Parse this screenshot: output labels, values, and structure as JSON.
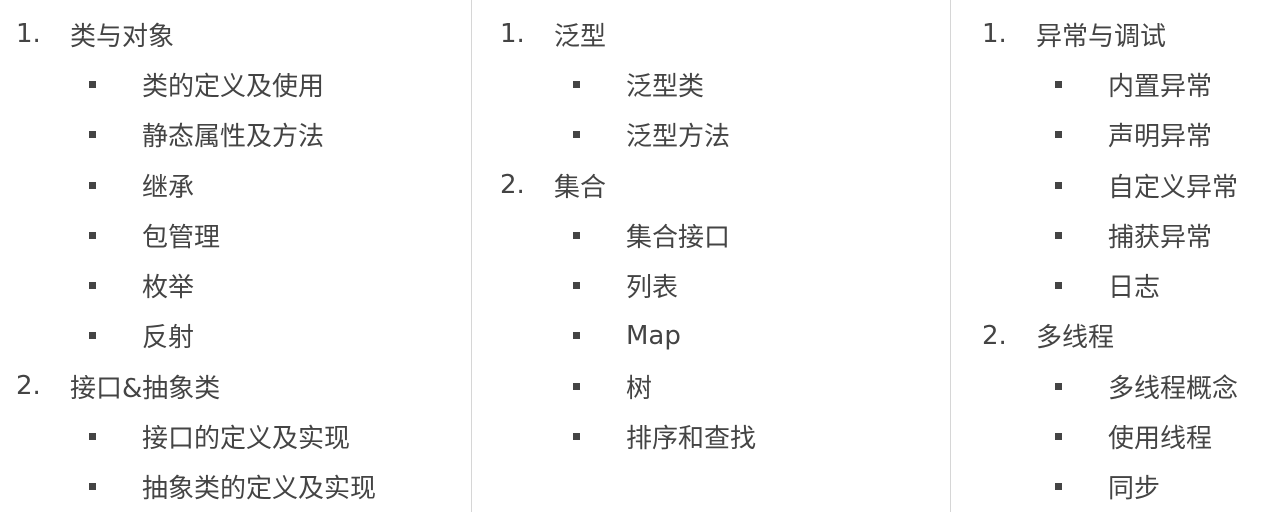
{
  "columns": [
    {
      "sections": [
        {
          "number": "1.",
          "title": "类与对象",
          "items": [
            "类的定义及使用",
            "静态属性及方法",
            "继承",
            "包管理",
            "枚举",
            "反射"
          ]
        },
        {
          "number": "2.",
          "title": "接口&抽象类",
          "items": [
            "接口的定义及实现",
            "抽象类的定义及实现"
          ]
        }
      ]
    },
    {
      "sections": [
        {
          "number": "1.",
          "title": "泛型",
          "items": [
            "泛型类",
            "泛型方法"
          ]
        },
        {
          "number": "2.",
          "title": "集合",
          "items": [
            "集合接口",
            "列表",
            "Map",
            "树",
            "排序和查找"
          ]
        }
      ]
    },
    {
      "sections": [
        {
          "number": "1.",
          "title": "异常与调试",
          "items": [
            "内置异常",
            "声明异常",
            "自定义异常",
            "捕获异常",
            "日志"
          ]
        },
        {
          "number": "2.",
          "title": "多线程",
          "items": [
            "多线程概念",
            "使用线程",
            "同步"
          ]
        }
      ]
    }
  ],
  "colors": {
    "text": "#444444",
    "divider": "#d6d6d6",
    "background": "#ffffff"
  },
  "icons": {
    "bullet": "square-bullet-icon"
  }
}
